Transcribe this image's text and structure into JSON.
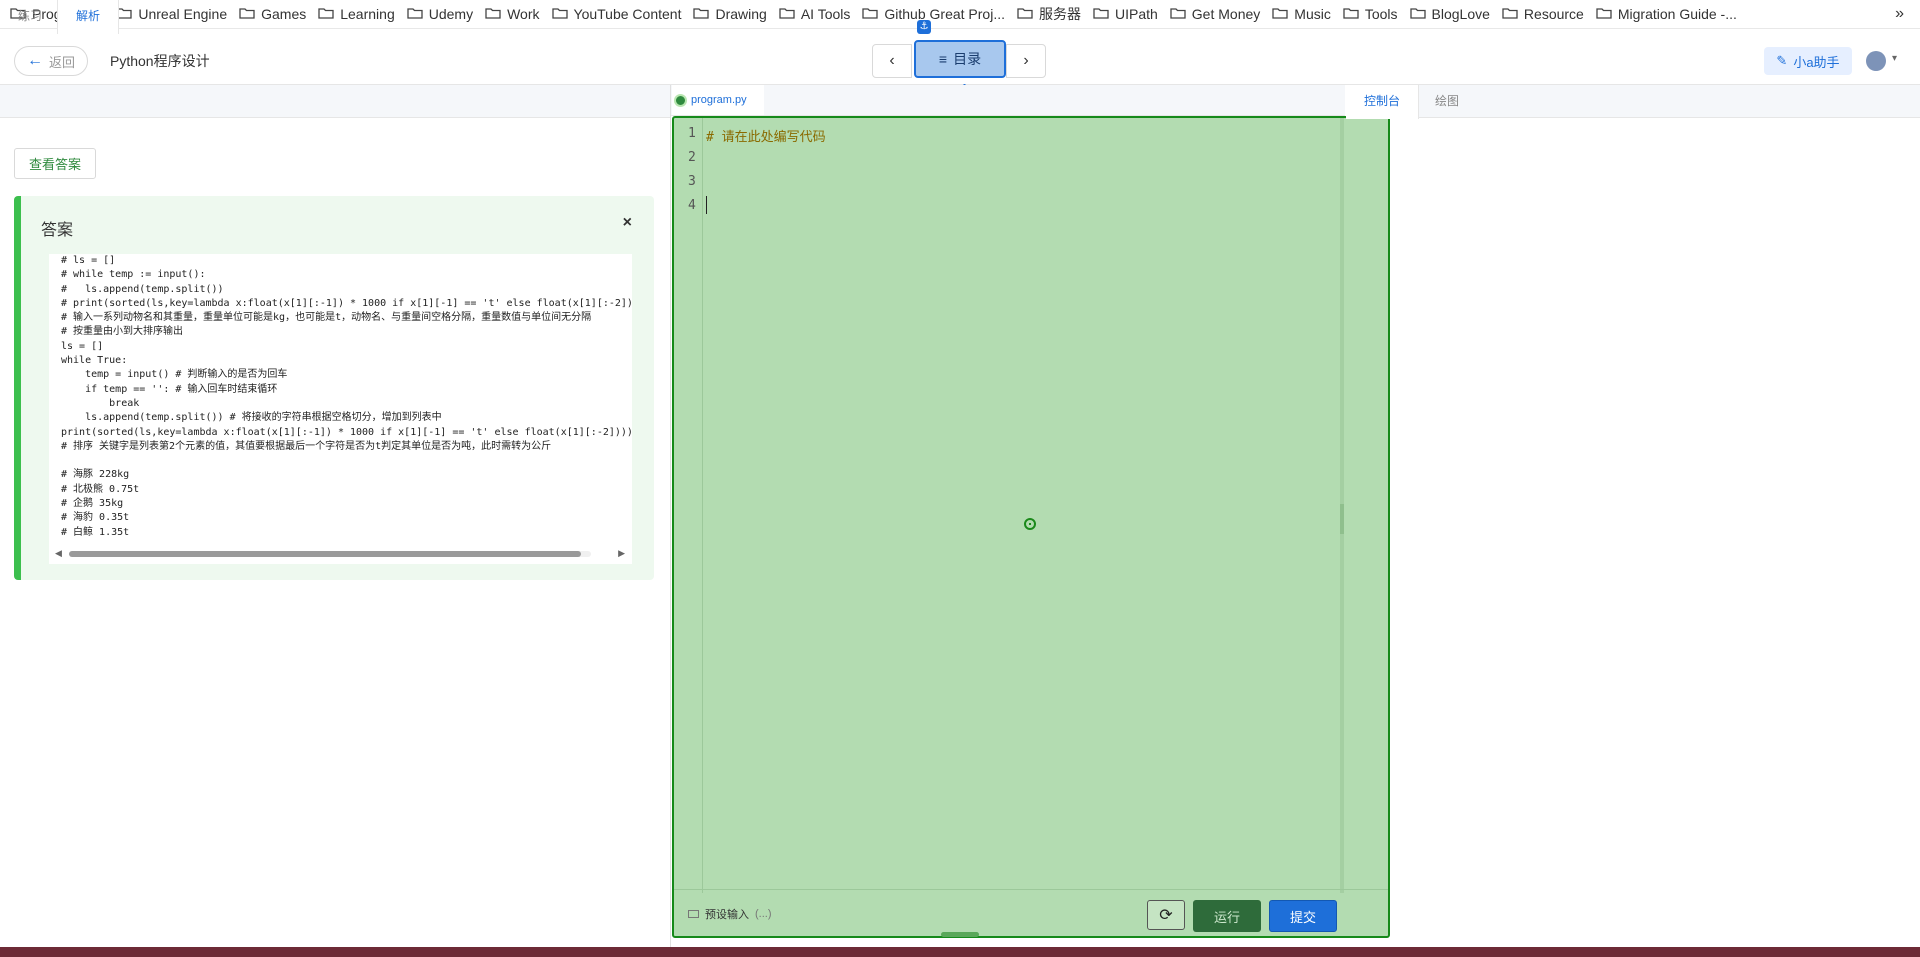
{
  "bookmarks": [
    "Programing",
    "Unreal Engine",
    "Games",
    "Learning",
    "Udemy",
    "Work",
    "YouTube Content",
    "Drawing",
    "AI Tools",
    "Github Great Proj...",
    "服务器",
    "UIPath",
    "Get Money",
    "Music",
    "Tools",
    "BlogLove",
    "Resource",
    "Migration Guide -..."
  ],
  "bookmarks_more": "»",
  "topbar": {
    "back_label": "返回",
    "course_title": "Python程序设计",
    "toc_label": "目录",
    "prev_icon": "‹",
    "next_icon": "›",
    "helper_label": "小a助手"
  },
  "left": {
    "tabs": [
      "练习",
      "解析"
    ],
    "view_answer": "查看答案",
    "answer_title": "答案",
    "answer_close": "×",
    "answer_code": "# ls = []\n# while temp := input():\n#   ls.append(temp.split())\n# print(sorted(ls,key=lambda x:float(x[1][:-1]) * 1000 if x[1][-1] == 't' else float(x[1][:-2])))\n# 输入一系列动物名和其重量，重量单位可能是kg，也可能是t，动物名、与重量间空格分隔，重量数值与单位间无分隔\n# 按重量由小到大排序输出\nls = []\nwhile True:\n    temp = input() # 判断输入的是否为回车\n    if temp == '': # 输入回车时结束循环\n        break\n    ls.append(temp.split()) # 将接收的字符串根据空格切分，增加到列表中\nprint(sorted(ls,key=lambda x:float(x[1][:-1]) * 1000 if x[1][-1] == 't' else float(x[1][:-2])))\n# 排序 关键字是列表第2个元素的值，其值要根据最后一个字符是否为t判定其单位是否为吨，此时需转为公斤\n\n# 海豚 228kg\n# 北极熊 0.75t\n# 企鹅 35kg\n# 海豹 0.35t\n# 白鲸 1.35t"
  },
  "editor": {
    "file_tab": "program.py",
    "line_numbers": [
      "1",
      "2",
      "3",
      "4"
    ],
    "first_line": "# 请在此处编写代码",
    "preset_label": "预设输入",
    "preset_dots": "(...)",
    "reset_icon": "⟳",
    "run_label": "运行",
    "submit_label": "提交"
  },
  "right": {
    "tabs": [
      "控制台",
      "绘图"
    ]
  },
  "colors": {
    "accent": "#1e6fd9",
    "editor_bg": "#b3dcb1",
    "editor_border": "#168a1a",
    "answer_bg": "#eef9ef",
    "answer_border": "#3cbf4e",
    "run_bg": "#2e6b3a"
  }
}
